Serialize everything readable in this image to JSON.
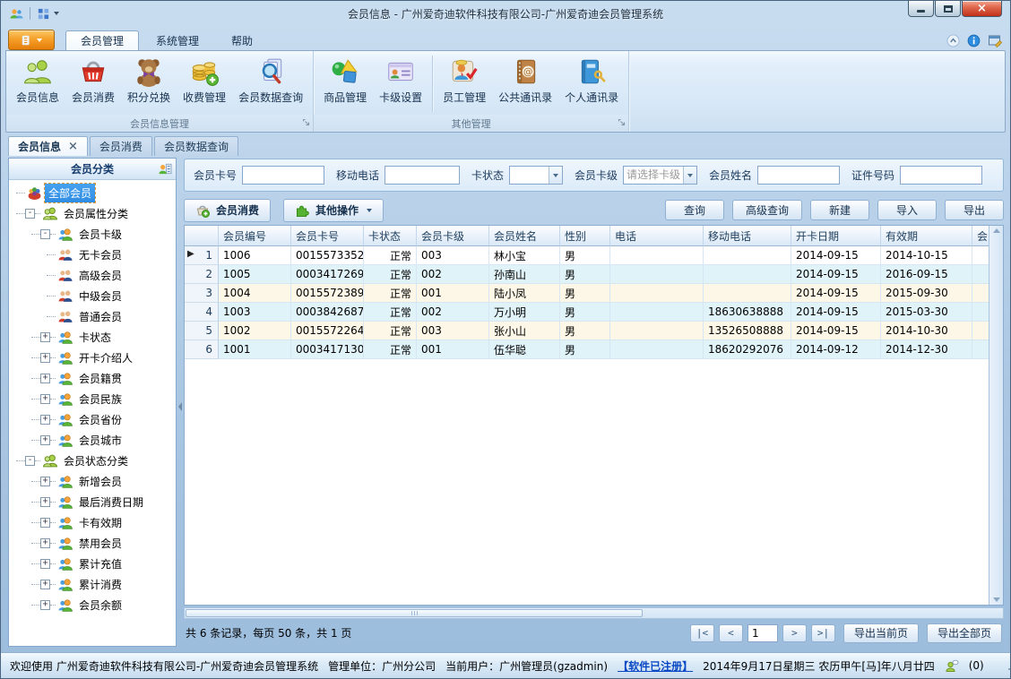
{
  "titlebar": {
    "title": "会员信息 - 广州爱奇迪软件科技有限公司-广州爱奇迪会员管理系统"
  },
  "ribbon_tabs": [
    {
      "label": "会员管理",
      "active": true
    },
    {
      "label": "系统管理",
      "active": false
    },
    {
      "label": "帮助",
      "active": false
    }
  ],
  "ribbon_groups": [
    {
      "label": "会员信息管理",
      "buttons": [
        {
          "label": "会员信息",
          "icon": "members-icon"
        },
        {
          "label": "会员消费",
          "icon": "basket-icon"
        },
        {
          "label": "积分兑换",
          "icon": "teddy-bear-icon"
        },
        {
          "label": "收费管理",
          "icon": "coins-add-icon"
        },
        {
          "label": "会员数据查询",
          "icon": "search-doc-icon"
        }
      ]
    },
    {
      "label": "其他管理",
      "buttons": [
        {
          "label": "商品管理",
          "icon": "goods-icon"
        },
        {
          "label": "卡级设置",
          "icon": "card-level-icon",
          "sep_after": true
        },
        {
          "label": "员工管理",
          "icon": "staff-icon"
        },
        {
          "label": "公共通讯录",
          "icon": "address-book-icon"
        },
        {
          "label": "个人通讯录",
          "icon": "personal-book-icon"
        }
      ]
    }
  ],
  "doc_tabs": [
    {
      "label": "会员信息",
      "active": true,
      "closable": true
    },
    {
      "label": "会员消费",
      "active": false
    },
    {
      "label": "会员数据查询",
      "active": false
    }
  ],
  "sidebar": {
    "header": "会员分类",
    "tree": [
      {
        "label": "全部会员",
        "level": 0,
        "icon": "all-members-icon",
        "selected": true
      },
      {
        "label": "会员属性分类",
        "level": 0,
        "expand": "minus",
        "icon": "green-group-icon"
      },
      {
        "label": "会员卡级",
        "level": 1,
        "expand": "minus",
        "icon": "orange-group-icon"
      },
      {
        "label": "无卡会员",
        "level": 2,
        "icon": "member-pair-icon"
      },
      {
        "label": "高级会员",
        "level": 2,
        "icon": "member-pair-icon"
      },
      {
        "label": "中级会员",
        "level": 2,
        "icon": "member-pair-icon"
      },
      {
        "label": "普通会员",
        "level": 2,
        "icon": "member-pair-icon"
      },
      {
        "label": "卡状态",
        "level": 1,
        "expand": "plus",
        "icon": "orange-group-icon"
      },
      {
        "label": "开卡介绍人",
        "level": 1,
        "expand": "plus",
        "icon": "orange-group-icon"
      },
      {
        "label": "会员籍贯",
        "level": 1,
        "expand": "plus",
        "icon": "orange-group-icon"
      },
      {
        "label": "会员民族",
        "level": 1,
        "expand": "plus",
        "icon": "orange-group-icon"
      },
      {
        "label": "会员省份",
        "level": 1,
        "expand": "plus",
        "icon": "orange-group-icon"
      },
      {
        "label": "会员城市",
        "level": 1,
        "expand": "plus",
        "icon": "orange-group-icon"
      },
      {
        "label": "会员状态分类",
        "level": 0,
        "expand": "minus",
        "icon": "green-group-icon"
      },
      {
        "label": "新增会员",
        "level": 1,
        "expand": "plus",
        "icon": "orange-group-icon"
      },
      {
        "label": "最后消费日期",
        "level": 1,
        "expand": "plus",
        "icon": "orange-group-icon"
      },
      {
        "label": "卡有效期",
        "level": 1,
        "expand": "plus",
        "icon": "orange-group-icon"
      },
      {
        "label": "禁用会员",
        "level": 1,
        "expand": "plus",
        "icon": "orange-group-icon"
      },
      {
        "label": "累计充值",
        "level": 1,
        "expand": "plus",
        "icon": "orange-group-icon"
      },
      {
        "label": "累计消费",
        "level": 1,
        "expand": "plus",
        "icon": "orange-group-icon"
      },
      {
        "label": "会员余额",
        "level": 1,
        "expand": "plus",
        "icon": "orange-group-icon"
      }
    ]
  },
  "search": {
    "fields": [
      {
        "name": "member-card-no",
        "label": "会员卡号",
        "type": "text",
        "value": "",
        "width": 92
      },
      {
        "name": "mobile-phone",
        "label": "移动电话",
        "type": "text",
        "value": "",
        "width": 84
      },
      {
        "name": "card-status",
        "label": "卡状态",
        "type": "select",
        "value": "",
        "placeholder": false,
        "width": 76
      },
      {
        "name": "card-level",
        "label": "会员卡级",
        "type": "select",
        "value": "请选择卡级",
        "placeholder": true,
        "width": 84
      },
      {
        "name": "member-name",
        "label": "会员姓名",
        "type": "text",
        "value": "",
        "width": 92
      },
      {
        "name": "id-number",
        "label": "证件号码",
        "type": "text",
        "value": "",
        "width": 92
      }
    ]
  },
  "toolbar": {
    "consume_button": "会员消费",
    "other_ops_button": "其他操作",
    "buttons": [
      "查询",
      "高级查询",
      "新建",
      "导入",
      "导出"
    ]
  },
  "grid": {
    "selected_row": 0,
    "columns": [
      {
        "label": "",
        "width": 38
      },
      {
        "label": "会员编号",
        "width": 81
      },
      {
        "label": "会员卡号",
        "width": 81
      },
      {
        "label": "卡状态",
        "width": 59,
        "align": "right"
      },
      {
        "label": "会员卡级",
        "width": 81
      },
      {
        "label": "会员姓名",
        "width": 79
      },
      {
        "label": "性别",
        "width": 56
      },
      {
        "label": "电话",
        "width": 104
      },
      {
        "label": "移动电话",
        "width": 98
      },
      {
        "label": "开卡日期",
        "width": 100
      },
      {
        "label": "有效期",
        "width": 102
      },
      {
        "label": "会员",
        "width": 60
      }
    ],
    "rows": [
      [
        "1",
        "1006",
        "0015573352",
        "正常",
        "003",
        "林小宝",
        "男",
        "",
        "",
        "2014-09-15",
        "2014-10-15",
        ""
      ],
      [
        "2",
        "1005",
        "0003417269",
        "正常",
        "002",
        "孙南山",
        "男",
        "",
        "",
        "2014-09-15",
        "2016-09-15",
        ""
      ],
      [
        "3",
        "1004",
        "0015572389",
        "正常",
        "001",
        "陆小凤",
        "男",
        "",
        "",
        "2014-09-15",
        "2015-09-30",
        ""
      ],
      [
        "4",
        "1003",
        "0003842687",
        "正常",
        "002",
        "万小明",
        "男",
        "",
        "18630638888",
        "2014-09-15",
        "2015-03-30",
        ""
      ],
      [
        "5",
        "1002",
        "0015572264",
        "正常",
        "003",
        "张小山",
        "男",
        "",
        "13526508888",
        "2014-09-15",
        "2014-10-30",
        ""
      ],
      [
        "6",
        "1001",
        "0003417130",
        "正常",
        "001",
        "伍华聪",
        "男",
        "",
        "18620292076",
        "2014-09-12",
        "2014-12-30",
        ""
      ]
    ]
  },
  "pager": {
    "summary": "共 6 条记录，每页 50 条，共 1 页",
    "nav_first": "|<",
    "nav_prev": "<",
    "page_value": "1",
    "nav_next": ">",
    "nav_last": ">|",
    "export_current": "导出当前页",
    "export_all": "导出全部页"
  },
  "statusbar": {
    "welcome": "欢迎使用 广州爱奇迪软件科技有限公司-广州爱奇迪会员管理系统",
    "org": "管理单位：广州分公司",
    "user": "当前用户：广州管理员(gzadmin)",
    "registered": "【软件已注册】",
    "datetime": "2014年9月17日星期三 农历甲午[马]年八月廿四",
    "message_count": "(0)"
  },
  "colors": {
    "row_cream": "#fcf7e6",
    "row_cyan": "#e0f3f9",
    "selection_blue": "#46a2f0",
    "link_blue": "#0948c4",
    "app_button_orange": "#f3980f",
    "close_button_red": "#c03018",
    "status_normal_text": "正常"
  }
}
